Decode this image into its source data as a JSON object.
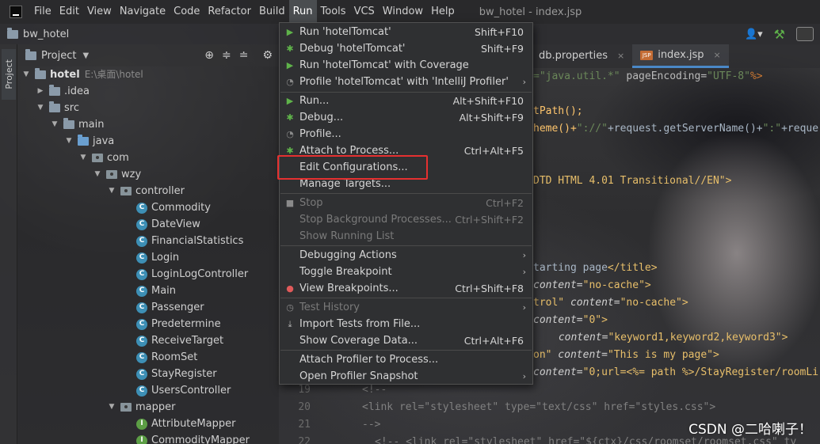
{
  "menubar": {
    "items": [
      "File",
      "Edit",
      "View",
      "Navigate",
      "Code",
      "Refactor",
      "Build",
      "Run",
      "Tools",
      "VCS",
      "Window",
      "Help"
    ],
    "window_title": "bw_hotel - index.jsp"
  },
  "navbar": {
    "project": "bw_hotel"
  },
  "left_stripe": {
    "project_tab": "Project"
  },
  "project_panel": {
    "title": "Project",
    "root": {
      "name": "hotel",
      "path": "E:\\桌面\\hotel"
    },
    "nodes": [
      ".idea",
      "src",
      "main",
      "java",
      "com",
      "wzy",
      "controller"
    ],
    "controllers": [
      "Commodity",
      "DateView",
      "FinancialStatistics",
      "Login",
      "LoginLogController",
      "Main",
      "Passenger",
      "Predetermine",
      "ReceiveTarget",
      "RoomSet",
      "StayRegister",
      "UsersController"
    ],
    "mapper_folder": "mapper",
    "mappers": [
      "AttributeMapper",
      "CommodityMapper"
    ]
  },
  "editor": {
    "tabs": [
      {
        "label": "db.properties",
        "close": "×"
      },
      {
        "label": "index.jsp",
        "close": "×",
        "icon": "JSP"
      }
    ],
    "code": {
      "l1_a": "=\"java.util.*\"",
      "l1_b": " pageEncoding=",
      "l1_c": "\"UTF-8\"",
      "l1_d": "%>",
      "l2": "tPath();",
      "l3_a": "heme()+",
      "l3_b": "\"://\"",
      "l3_c": "+request.getServerName()+",
      "l3_d": "\":\"",
      "l3_e": "+reque",
      "l4": "DTD HTML 4.01 Transitional//EN\">",
      "l5_a": "tarting page",
      "l5_b": "</title>",
      "l6_a": "content=",
      "l6_b": "\"no-cache\"",
      "l6_c": ">",
      "l7_a": "trol\"",
      "l7_b": " content=",
      "l7_c": "\"no-cache\"",
      "l7_d": ">",
      "l8_a": "content=",
      "l8_b": "\"0\"",
      "l8_c": ">",
      "l9_a": " content=",
      "l9_b": "\"keyword1,keyword2,keyword3\"",
      "l9_c": ">",
      "l10_a": "on\"",
      "l10_b": " content=",
      "l10_c": "\"This is my page\"",
      "l10_d": ">",
      "l11_a": "content=",
      "l11_b": "\"0;url=<%= path %>/StayRegister/roomLi",
      "n19": "19",
      "l19": "<!--",
      "n20": "20",
      "l20_a": "<link ",
      "l20_b": "rel=",
      "l20_c": "\"stylesheet\"",
      "l20_d": " type=",
      "l20_e": "\"text/css\"",
      "l20_f": " href=",
      "l20_g": "\"styles.css\"",
      "l20_h": ">",
      "n21": "21",
      "l21": "-->",
      "n22": "22",
      "l22_a": "<!-- ",
      "l22_b": "<link rel=\"stylesheet\" href=\"${ctx}/css/roomset/roomset.css\" ty"
    }
  },
  "run_menu": {
    "items": [
      {
        "label": "Run 'hotelTomcat'",
        "shortcut": "Shift+F10"
      },
      {
        "label": "Debug 'hotelTomcat'",
        "shortcut": "Shift+F9"
      },
      {
        "label": "Run 'hotelTomcat' with Coverage",
        "shortcut": ""
      },
      {
        "label": "Profile 'hotelTomcat' with 'IntelliJ Profiler'",
        "shortcut": ""
      },
      {
        "label": "Run...",
        "shortcut": "Alt+Shift+F10"
      },
      {
        "label": "Debug...",
        "shortcut": "Alt+Shift+F9"
      },
      {
        "label": "Profile...",
        "shortcut": ""
      },
      {
        "label": "Attach to Process...",
        "shortcut": "Ctrl+Alt+F5"
      },
      {
        "label": "Edit Configurations...",
        "shortcut": ""
      },
      {
        "label": "Manage Targets...",
        "shortcut": ""
      },
      {
        "label": "Stop",
        "shortcut": "Ctrl+F2"
      },
      {
        "label": "Stop Background Processes...",
        "shortcut": "Ctrl+Shift+F2"
      },
      {
        "label": "Show Running List",
        "shortcut": ""
      },
      {
        "label": "Debugging Actions",
        "shortcut": ""
      },
      {
        "label": "Toggle Breakpoint",
        "shortcut": ""
      },
      {
        "label": "View Breakpoints...",
        "shortcut": "Ctrl+Shift+F8"
      },
      {
        "label": "Test History",
        "shortcut": ""
      },
      {
        "label": "Import Tests from File...",
        "shortcut": ""
      },
      {
        "label": "Show Coverage Data...",
        "shortcut": "Ctrl+Alt+F6"
      },
      {
        "label": "Attach Profiler to Process...",
        "shortcut": ""
      },
      {
        "label": "Open Profiler Snapshot",
        "shortcut": ""
      }
    ],
    "submenu_arrow": "›"
  },
  "watermark": "CSDN @二哈喇子！",
  "colors": {
    "accent": "#4a88c7",
    "highlight": "#e53030",
    "run_green": "#5fb34a"
  }
}
